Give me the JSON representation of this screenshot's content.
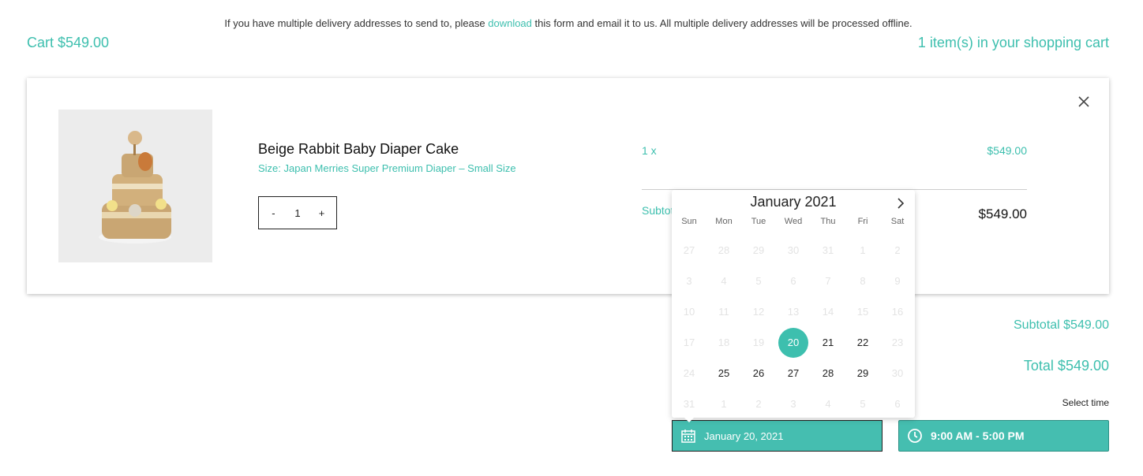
{
  "notice": {
    "before": "If you have multiple delivery addresses to send to, please ",
    "link": "download",
    "after": " this form and email it to us. All multiple delivery addresses will be processed offline."
  },
  "header": {
    "cart_total": "Cart $549.00",
    "item_count": "1 item(s) in your shopping cart"
  },
  "item": {
    "name": "Beige Rabbit Baby Diaper Cake",
    "variant": "Size: Japan Merries Super Premium Diaper – Small Size",
    "qty_minus": "-",
    "qty": "1",
    "qty_plus": "+",
    "qty_label": "1 x",
    "price": "$549.00",
    "subtotal_label": "Subtotal",
    "subtotal_value": "$549.00"
  },
  "summary": {
    "subtotal": "Subtotal $549.00",
    "total": "Total $549.00",
    "select_time": "Select time"
  },
  "delivery": {
    "date_value": "January 20, 2021",
    "time_value": "9:00 AM - 5:00 PM"
  },
  "calendar": {
    "title": "January 2021",
    "weekdays": [
      "Sun",
      "Mon",
      "Tue",
      "Wed",
      "Thu",
      "Fri",
      "Sat"
    ],
    "days": [
      {
        "d": "27",
        "s": "disabled"
      },
      {
        "d": "28",
        "s": "disabled"
      },
      {
        "d": "29",
        "s": "disabled"
      },
      {
        "d": "30",
        "s": "disabled"
      },
      {
        "d": "31",
        "s": "disabled"
      },
      {
        "d": "1",
        "s": "disabled"
      },
      {
        "d": "2",
        "s": "disabled"
      },
      {
        "d": "3",
        "s": "disabled"
      },
      {
        "d": "4",
        "s": "disabled"
      },
      {
        "d": "5",
        "s": "disabled"
      },
      {
        "d": "6",
        "s": "disabled"
      },
      {
        "d": "7",
        "s": "disabled"
      },
      {
        "d": "8",
        "s": "disabled"
      },
      {
        "d": "9",
        "s": "disabled"
      },
      {
        "d": "10",
        "s": "disabled"
      },
      {
        "d": "11",
        "s": "disabled"
      },
      {
        "d": "12",
        "s": "disabled"
      },
      {
        "d": "13",
        "s": "disabled"
      },
      {
        "d": "14",
        "s": "disabled"
      },
      {
        "d": "15",
        "s": "disabled"
      },
      {
        "d": "16",
        "s": "disabled"
      },
      {
        "d": "17",
        "s": "disabled"
      },
      {
        "d": "18",
        "s": "disabled"
      },
      {
        "d": "19",
        "s": "disabled"
      },
      {
        "d": "20",
        "s": "selected"
      },
      {
        "d": "21",
        "s": "active"
      },
      {
        "d": "22",
        "s": "active"
      },
      {
        "d": "23",
        "s": "disabled"
      },
      {
        "d": "24",
        "s": "disabled"
      },
      {
        "d": "25",
        "s": "active"
      },
      {
        "d": "26",
        "s": "active"
      },
      {
        "d": "27",
        "s": "active"
      },
      {
        "d": "28",
        "s": "active"
      },
      {
        "d": "29",
        "s": "active"
      },
      {
        "d": "30",
        "s": "disabled"
      },
      {
        "d": "31",
        "s": "disabled"
      },
      {
        "d": "1",
        "s": "disabled"
      },
      {
        "d": "2",
        "s": "disabled"
      },
      {
        "d": "3",
        "s": "disabled"
      },
      {
        "d": "4",
        "s": "disabled"
      },
      {
        "d": "5",
        "s": "disabled"
      },
      {
        "d": "6",
        "s": "disabled"
      }
    ]
  },
  "icons": {
    "close": "close-icon",
    "next": "chevron-right-icon",
    "calendar": "calendar-icon",
    "clock": "clock-icon"
  },
  "colors": {
    "accent": "#3dbfae",
    "field_bg": "#45beb0"
  }
}
